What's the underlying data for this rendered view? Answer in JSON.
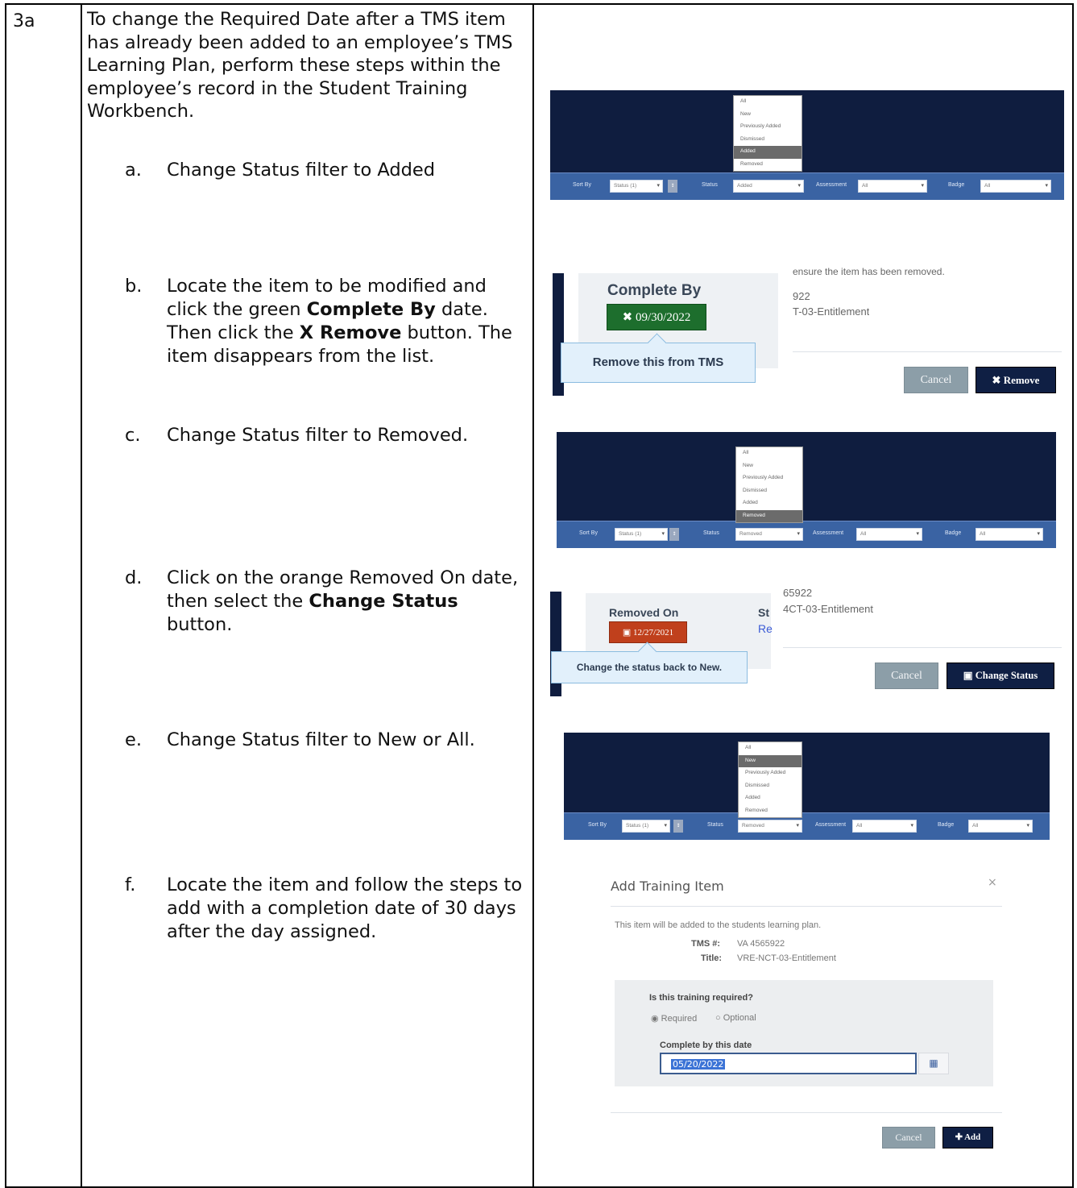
{
  "step_number": "3a",
  "intro": "To change the Required Date after a TMS item has already been added to an employee’s TMS Learning Plan, perform these steps within the employee’s record in the Student Training Workbench.",
  "steps": [
    {
      "letter": "a.",
      "text": "Change Status filter to Added"
    },
    {
      "letter": "b.",
      "pre": "Locate the item to be modified and click the green ",
      "bold1": "Complete By",
      "mid": " date. Then click the ",
      "bold2": "X Remove",
      "post": " button.  The item disappears from the list."
    },
    {
      "letter": "c.",
      "text": "Change Status filter to Removed."
    },
    {
      "letter": "d.",
      "pre": "Click on the orange Removed On date, then select the ",
      "bold1": "Change Status",
      "post": " button."
    },
    {
      "letter": "e.",
      "text": "Change Status filter to New or All."
    },
    {
      "letter": "f.",
      "text": "Locate the item and follow the steps to add with a completion date of 30 days after the day assigned."
    }
  ],
  "filter_labels": {
    "sort_by": "Sort By",
    "status": "Status",
    "assessment": "Assessment",
    "badge": "Badge",
    "sort_value": "Status (1)",
    "all": "All",
    "btn": "↕"
  },
  "status_options": [
    "All",
    "New",
    "Previously Added",
    "Dismissed",
    "Added",
    "Removed"
  ],
  "filter_a": {
    "status_value": "Added",
    "selected": "Added"
  },
  "filter_c": {
    "status_value": "Removed",
    "selected": "Removed"
  },
  "filter_e": {
    "status_value": "Removed",
    "selected": "New"
  },
  "remove_shot": {
    "side_top": "ensure the item has been removed.",
    "side_id": "922",
    "side_title": "T-03-Entitlement",
    "complete_by_title": "Complete By",
    "date_label": "✖ 09/30/2022",
    "tooltip": "Remove this from TMS",
    "cancel": "Cancel",
    "remove": "✖ Remove"
  },
  "change_shot": {
    "side_id": "65922",
    "side_title": "4CT-03-Entitlement",
    "removed_on_title": "Removed On",
    "date_label": "▣ 12/27/2021",
    "st_label": "St",
    "re_label": "Re",
    "tooltip": "Change the status back to New.",
    "cancel": "Cancel",
    "change_status": "▣ Change Status"
  },
  "add_dialog": {
    "title": "Add Training Item",
    "close": "×",
    "note": "This item will be added to the students learning plan.",
    "tms_label": "TMS #:",
    "tms_value": "VA 4565922",
    "title_label": "Title:",
    "title_value": "VRE-NCT-03-Entitlement",
    "question": "Is this training required?",
    "opt_required": "Required",
    "opt_optional": "Optional",
    "date_label": "Complete by this date",
    "date_value": "05/20/2022",
    "cancel": "Cancel",
    "add": "✚ Add"
  },
  "colors": {
    "navy": "#0f1d3f",
    "filter_bar": "#3a63a3",
    "green": "#1d6e2d",
    "orange": "#c0401c"
  }
}
